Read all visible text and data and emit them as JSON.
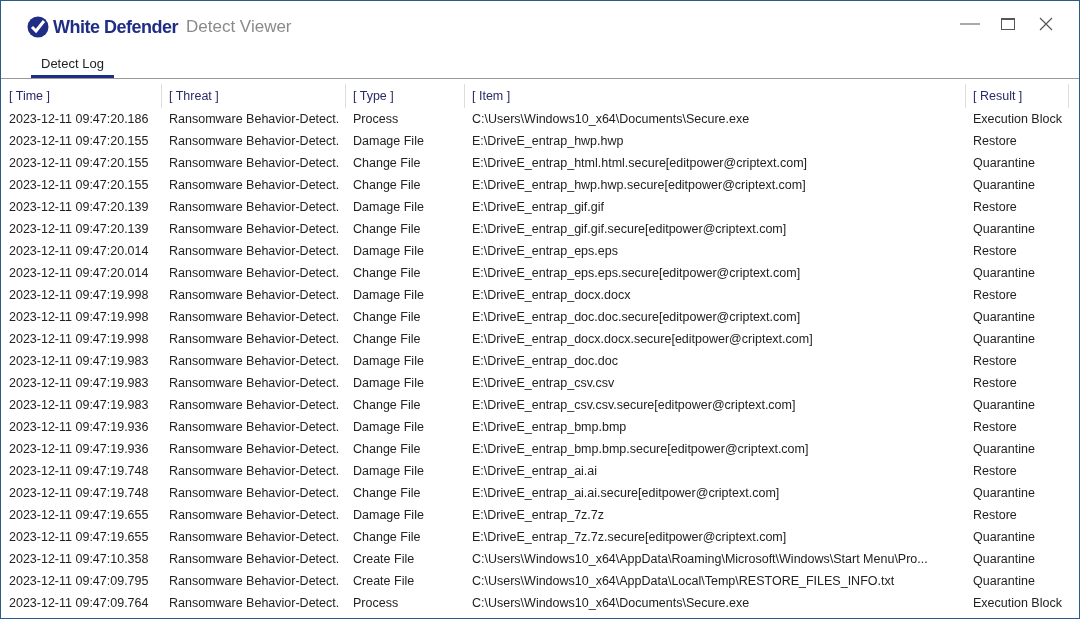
{
  "window": {
    "brand": "White Defender",
    "title": "Detect Viewer"
  },
  "tabs": [
    {
      "label": "Detect Log",
      "selected": true
    }
  ],
  "table": {
    "columns": [
      "[ Time ]",
      "[ Threat ]",
      "[ Type ]",
      "[ Item ]",
      "[ Result ]"
    ],
    "rows": [
      [
        "2023-12-11 09:47:20.186",
        "Ransomware Behavior-Detect.",
        "Process",
        "C:\\Users\\Windows10_x64\\Documents\\Secure.exe",
        "Execution Block"
      ],
      [
        "2023-12-11 09:47:20.155",
        "Ransomware Behavior-Detect.",
        "Damage File",
        "E:\\DriveE_entrap_hwp.hwp",
        "Restore"
      ],
      [
        "2023-12-11 09:47:20.155",
        "Ransomware Behavior-Detect.",
        "Change File",
        "E:\\DriveE_entrap_html.html.secure[editpower@criptext.com]",
        "Quarantine"
      ],
      [
        "2023-12-11 09:47:20.155",
        "Ransomware Behavior-Detect.",
        "Change File",
        "E:\\DriveE_entrap_hwp.hwp.secure[editpower@criptext.com]",
        "Quarantine"
      ],
      [
        "2023-12-11 09:47:20.139",
        "Ransomware Behavior-Detect.",
        "Damage File",
        "E:\\DriveE_entrap_gif.gif",
        "Restore"
      ],
      [
        "2023-12-11 09:47:20.139",
        "Ransomware Behavior-Detect.",
        "Change File",
        "E:\\DriveE_entrap_gif.gif.secure[editpower@criptext.com]",
        "Quarantine"
      ],
      [
        "2023-12-11 09:47:20.014",
        "Ransomware Behavior-Detect.",
        "Damage File",
        "E:\\DriveE_entrap_eps.eps",
        "Restore"
      ],
      [
        "2023-12-11 09:47:20.014",
        "Ransomware Behavior-Detect.",
        "Change File",
        "E:\\DriveE_entrap_eps.eps.secure[editpower@criptext.com]",
        "Quarantine"
      ],
      [
        "2023-12-11 09:47:19.998",
        "Ransomware Behavior-Detect.",
        "Damage File",
        "E:\\DriveE_entrap_docx.docx",
        "Restore"
      ],
      [
        "2023-12-11 09:47:19.998",
        "Ransomware Behavior-Detect.",
        "Change File",
        "E:\\DriveE_entrap_doc.doc.secure[editpower@criptext.com]",
        "Quarantine"
      ],
      [
        "2023-12-11 09:47:19.998",
        "Ransomware Behavior-Detect.",
        "Change File",
        "E:\\DriveE_entrap_docx.docx.secure[editpower@criptext.com]",
        "Quarantine"
      ],
      [
        "2023-12-11 09:47:19.983",
        "Ransomware Behavior-Detect.",
        "Damage File",
        "E:\\DriveE_entrap_doc.doc",
        "Restore"
      ],
      [
        "2023-12-11 09:47:19.983",
        "Ransomware Behavior-Detect.",
        "Damage File",
        "E:\\DriveE_entrap_csv.csv",
        "Restore"
      ],
      [
        "2023-12-11 09:47:19.983",
        "Ransomware Behavior-Detect.",
        "Change File",
        "E:\\DriveE_entrap_csv.csv.secure[editpower@criptext.com]",
        "Quarantine"
      ],
      [
        "2023-12-11 09:47:19.936",
        "Ransomware Behavior-Detect.",
        "Damage File",
        "E:\\DriveE_entrap_bmp.bmp",
        "Restore"
      ],
      [
        "2023-12-11 09:47:19.936",
        "Ransomware Behavior-Detect.",
        "Change File",
        "E:\\DriveE_entrap_bmp.bmp.secure[editpower@criptext.com]",
        "Quarantine"
      ],
      [
        "2023-12-11 09:47:19.748",
        "Ransomware Behavior-Detect.",
        "Damage File",
        "E:\\DriveE_entrap_ai.ai",
        "Restore"
      ],
      [
        "2023-12-11 09:47:19.748",
        "Ransomware Behavior-Detect.",
        "Change File",
        "E:\\DriveE_entrap_ai.ai.secure[editpower@criptext.com]",
        "Quarantine"
      ],
      [
        "2023-12-11 09:47:19.655",
        "Ransomware Behavior-Detect.",
        "Damage File",
        "E:\\DriveE_entrap_7z.7z",
        "Restore"
      ],
      [
        "2023-12-11 09:47:19.655",
        "Ransomware Behavior-Detect.",
        "Change File",
        "E:\\DriveE_entrap_7z.7z.secure[editpower@criptext.com]",
        "Quarantine"
      ],
      [
        "2023-12-11 09:47:10.358",
        "Ransomware Behavior-Detect.",
        "Create File",
        "C:\\Users\\Windows10_x64\\AppData\\Roaming\\Microsoft\\Windows\\Start Menu\\Pro...",
        "Quarantine"
      ],
      [
        "2023-12-11 09:47:09.795",
        "Ransomware Behavior-Detect.",
        "Create File",
        "C:\\Users\\Windows10_x64\\AppData\\Local\\Temp\\RESTORE_FILES_INFO.txt",
        "Quarantine"
      ],
      [
        "2023-12-11 09:47:09.764",
        "Ransomware Behavior-Detect.",
        "Process",
        "C:\\Users\\Windows10_x64\\Documents\\Secure.exe",
        "Execution Block"
      ]
    ]
  }
}
